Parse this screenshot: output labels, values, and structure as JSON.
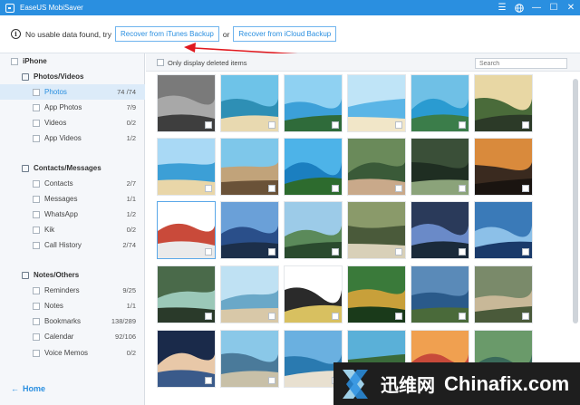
{
  "window": {
    "title": "EaseUS MobiSaver",
    "controls": {
      "menu": "☰",
      "globe": "🌐",
      "minimize": "—",
      "maximize": "☐",
      "close": "✕"
    }
  },
  "notice": {
    "text": "No usable data found, try",
    "itunes_button": "Recover from iTunes Backup",
    "or_text": "or",
    "icloud_button": "Recover from iCloud Backup",
    "info_glyph": "i",
    "arrow_color": "#e0191f"
  },
  "sidebar": {
    "root": "iPhone",
    "groups": [
      {
        "label": "Photos/Videos",
        "items": [
          {
            "label": "Photos",
            "count": "74 /74",
            "selected": true
          },
          {
            "label": "App Photos",
            "count": "7/9"
          },
          {
            "label": "Videos",
            "count": "0/2"
          },
          {
            "label": "App Videos",
            "count": "1/2"
          }
        ]
      },
      {
        "label": "Contacts/Messages",
        "items": [
          {
            "label": "Contacts",
            "count": "2/7"
          },
          {
            "label": "Messages",
            "count": "1/1"
          },
          {
            "label": "WhatsApp",
            "count": "1/2"
          },
          {
            "label": "Kik",
            "count": "0/2"
          },
          {
            "label": "Call History",
            "count": "2/74"
          }
        ]
      },
      {
        "label": "Notes/Others",
        "items": [
          {
            "label": "Reminders",
            "count": "9/25"
          },
          {
            "label": "Notes",
            "count": "1/1"
          },
          {
            "label": "Bookmarks",
            "count": "138/289"
          },
          {
            "label": "Calendar",
            "count": "92/106"
          },
          {
            "label": "Voice Memos",
            "count": "0/2"
          }
        ]
      }
    ],
    "home_label": "Home",
    "home_arrow": "←"
  },
  "main": {
    "filter_label": "Only display deleted items",
    "search_placeholder": "Search"
  },
  "watermark": {
    "cn_text": "迅维网",
    "en_text": "Chinafix.com"
  },
  "colors": {
    "accent": "#2a8fe0",
    "sidebar_bg": "#f5f7fa",
    "selected_bg": "#dcebf9"
  }
}
